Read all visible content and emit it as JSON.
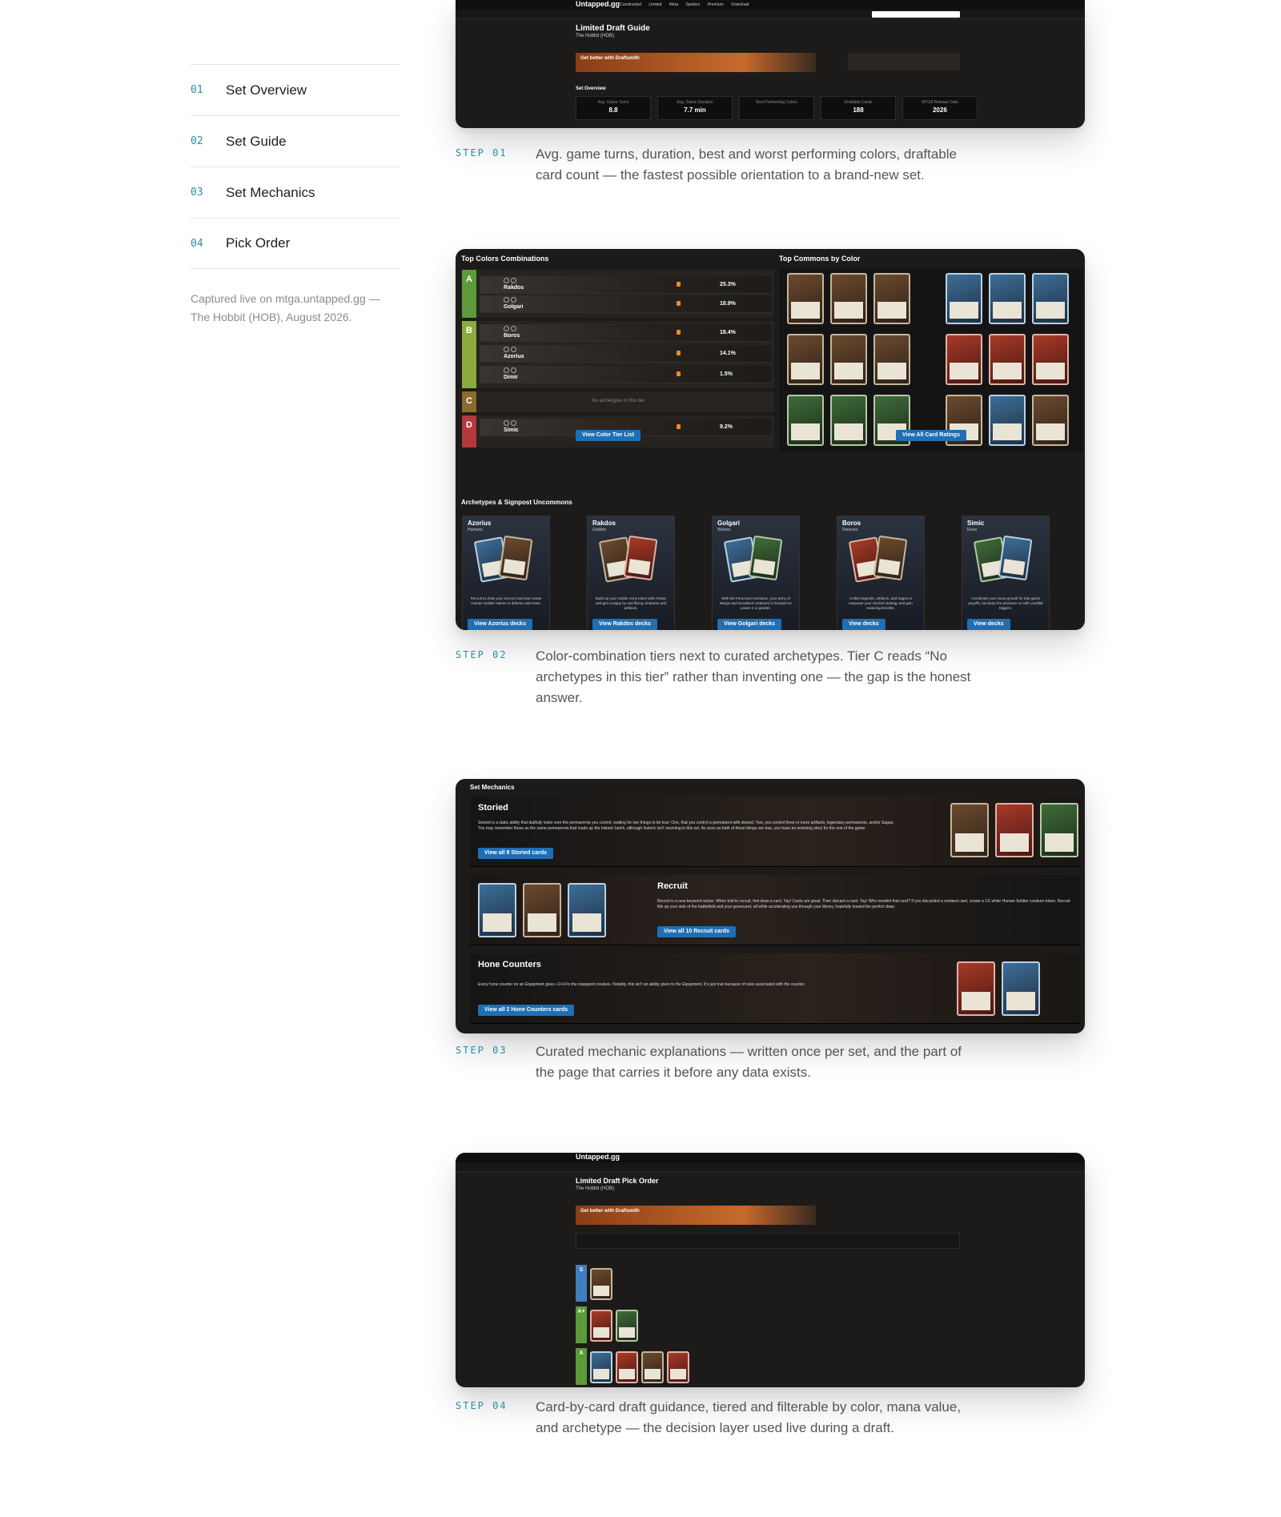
{
  "nav": {
    "items": [
      {
        "num": "01",
        "label": "Set Overview"
      },
      {
        "num": "02",
        "label": "Set Guide"
      },
      {
        "num": "03",
        "label": "Set Mechanics"
      },
      {
        "num": "04",
        "label": "Pick Order"
      }
    ],
    "caption": "Captured live on mtga.untapped.gg — The Hobbit (HOB), August 2026."
  },
  "steps": [
    {
      "label": "STEP 01",
      "text": "Avg. game turns, duration, best and worst performing colors, draftable card count — the fastest possible orientation to a brand-new set."
    },
    {
      "label": "STEP 02",
      "text": "Color-combination tiers next to curated archetypes. Tier C reads “No archetypes in this tier” rather than inventing one — the gap is the honest answer."
    },
    {
      "label": "STEP 03",
      "text": "Curated mechanic explanations — written once per set, and the part of the page that carries it before any data exists."
    },
    {
      "label": "STEP 04",
      "text": "Card-by-card draft guidance, tiered and filterable by color, mana value, and archetype — the decision layer used live during a draft."
    }
  ],
  "shot1": {
    "logo": "Untapped.gg",
    "nav": "Constructed Limited Meta Spoilers Premium Download",
    "title": "Limited Draft Guide",
    "subtitle": "The Hobbit (HOB)",
    "banner": "Get better with Draftsmith",
    "overview": "Set Overview",
    "stats": [
      {
        "label": "Avg. Game Turns",
        "value": "8.8"
      },
      {
        "label": "Avg. Game Duration",
        "value": "7.7 min"
      },
      {
        "label": "Best Performing Colors",
        "value": ""
      },
      {
        "label": "Draftable Cards",
        "value": "188"
      },
      {
        "label": "MTGA Release Date",
        "value": "2026"
      }
    ]
  },
  "shot2": {
    "tiers_title": "Top Colors Combinations",
    "commons_title": "Top Commons by Color",
    "tiers": [
      {
        "letter": "A",
        "color": "#5c9a3a",
        "rows": [
          {
            "name": "Rakdos",
            "pct": "25.3%"
          },
          {
            "name": "Golgari",
            "pct": "18.9%"
          }
        ]
      },
      {
        "letter": "B",
        "color": "#8bab3b",
        "rows": [
          {
            "name": "Boros",
            "pct": "18.4%"
          },
          {
            "name": "Azorius",
            "pct": "14.1%"
          },
          {
            "name": "Dimir",
            "pct": "1.5%"
          }
        ]
      },
      {
        "letter": "C",
        "color": "#8b6a2e",
        "empty": "No archetypes in this tier"
      },
      {
        "letter": "D",
        "color": "#b23a3a",
        "rows": [
          {
            "name": "Simic",
            "pct": "9.2%"
          }
        ]
      }
    ],
    "tier_cta": "View Color Tier List",
    "ratings_cta": "View All Card Ratings",
    "archetypes_title": "Archetypes & Signpost Uncommons",
    "archetypes": [
      {
        "name": "Azorius",
        "sub": "Humans",
        "desc": "Recruit to draw your second card and create Human Soldier tokens to defend Lake-town.",
        "cta": "View Azorius decks"
      },
      {
        "name": "Rakdos",
        "sub": "Goblins",
        "desc": "Build up your Goblin Army token with Amass and get scrappy by sacrificing creatures and artifacts.",
        "cta": "View Rakdos decks"
      },
      {
        "name": "Golgari",
        "sub": "Wolves",
        "desc": "With the Ferocious mechanic, your army of Wargs and woodland creatures is focused on power 4 or greater.",
        "cta": "View Golgari decks"
      },
      {
        "name": "Boros",
        "sub": "Dwarves",
        "desc": "Collect legends, artifacts, and Sagas to empower your Storied strategy and gain enduring benefits.",
        "cta": "View decks"
      },
      {
        "name": "Simic",
        "sub": "Elves",
        "desc": "Accelerate your mana growth for late-game payoffs, but keep the pressure on with Landfall triggers.",
        "cta": "View decks"
      }
    ]
  },
  "shot3": {
    "title": "Set Mechanics",
    "mechanics": [
      {
        "name": "Storied",
        "desc": "Storied is a static ability that dutifully looks over the permanents you control, waiting for two things to be true: One, that you control a permanent with storied. Two, you control three or more artifacts, legendary permanents, and/or Sagas. You may remember these as the same permanents that made up the historic batch, although historic isn't returning in this set. As soon as both of those things are true, you have an enduring story for the rest of the game.",
        "cta": "View all 9 Storied cards"
      },
      {
        "name": "Recruit",
        "desc": "Recruit is a new keyword action. When told to recruit, first draw a card. Yay! Cards are great. Then discard a card. Yay! Who needed that card? If you discarded a nonland card, create a 1/1 white Human Soldier creature token. Recruit fills up your side of the battlefield and your graveyard, all while accelerating you through your library, hopefully toward the perfect draw.",
        "cta": "View all 10 Recruit cards"
      },
      {
        "name": "Hone Counters",
        "desc": "Every hone counter on an Equipment gives +1/+0 to the equipped creature. Notably, this isn't an ability given to the Equipment. It's just true because of rules associated with the counter.",
        "cta": "View all 2 Hone Counters cards"
      }
    ]
  },
  "shot4": {
    "logo": "Untapped.gg",
    "title": "Limited Draft Pick Order",
    "subtitle": "The Hobbit (HOB)",
    "banner": "Get better with Draftsmith",
    "tiers": [
      {
        "letter": "S",
        "color": "#3f7fc0"
      },
      {
        "letter": "A+",
        "color": "#5c9a3a"
      },
      {
        "letter": "A",
        "color": "#5c9a3a"
      }
    ]
  }
}
